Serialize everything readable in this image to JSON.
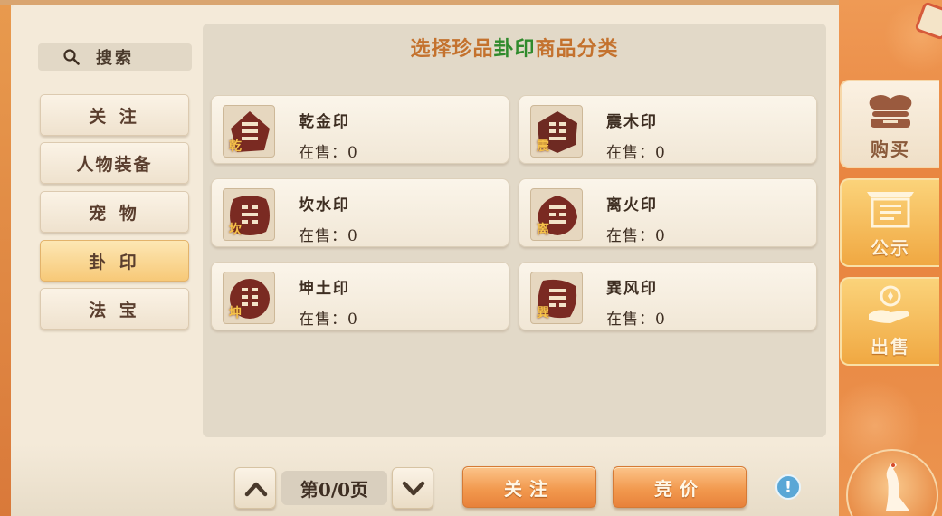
{
  "search": {
    "label": "搜索"
  },
  "categories": [
    {
      "label": "关 注",
      "active": false
    },
    {
      "label": "人物装备",
      "active": false
    },
    {
      "label": "宠 物",
      "active": false
    },
    {
      "label": "卦 印",
      "active": true
    },
    {
      "label": "法 宝",
      "active": false
    }
  ],
  "title": {
    "prefix": "选择珍品",
    "highlight": "卦印",
    "suffix": "商品分类"
  },
  "items": [
    {
      "name": "乾金印",
      "stock": "在售：0",
      "seal_char": "乾"
    },
    {
      "name": "震木印",
      "stock": "在售：0",
      "seal_char": "震"
    },
    {
      "name": "坎水印",
      "stock": "在售：0",
      "seal_char": "坎"
    },
    {
      "name": "离火印",
      "stock": "在售：0",
      "seal_char": "离"
    },
    {
      "name": "坤土印",
      "stock": "在售：0",
      "seal_char": "坤"
    },
    {
      "name": "巽风印",
      "stock": "在售：0",
      "seal_char": "巽"
    }
  ],
  "pagination": {
    "indicator": "第0/0页"
  },
  "actions": {
    "follow": "关注",
    "bid": "竞价"
  },
  "sidebar": {
    "tabs": [
      {
        "label": "购买",
        "active": true
      },
      {
        "label": "公示",
        "active": false
      },
      {
        "label": "出售",
        "active": false
      }
    ]
  },
  "colors": {
    "accent_orange": "#c4722e",
    "accent_green": "#2f8a2c",
    "seal_red": "#7a2a22"
  }
}
